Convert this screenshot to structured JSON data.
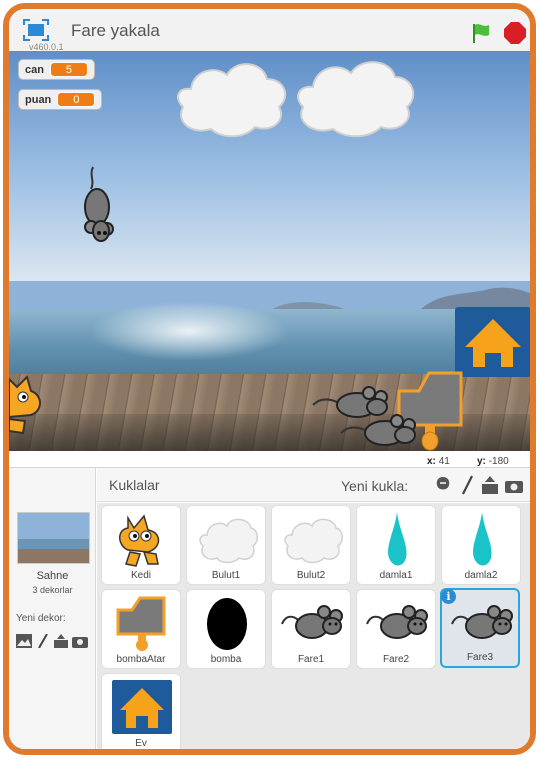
{
  "project": {
    "title": "Fare yakala",
    "version": "v460.0.1"
  },
  "variables": [
    {
      "name": "can",
      "value": "5"
    },
    {
      "name": "puan",
      "value": "0"
    }
  ],
  "coords": {
    "x_label": "x:",
    "x_value": "41",
    "y_label": "y:",
    "y_value": "-180"
  },
  "sprites_pane": {
    "title": "Kuklalar",
    "new_sprite_label": "Yeni kukla:"
  },
  "stage": {
    "name": "Sahne",
    "backdrop_count": "3 dekorlar",
    "new_backdrop_label": "Yeni dekor:"
  },
  "sprites": [
    {
      "name": "Kedi"
    },
    {
      "name": "Bulut1"
    },
    {
      "name": "Bulut2"
    },
    {
      "name": "damla1"
    },
    {
      "name": "damla2"
    },
    {
      "name": "bombaAtar"
    },
    {
      "name": "bomba"
    },
    {
      "name": "Fare1"
    },
    {
      "name": "Fare2"
    },
    {
      "name": "Fare3",
      "selected": true
    },
    {
      "name": "Ev"
    }
  ],
  "colors": {
    "frame": "#e07a2c",
    "monitor_value": "#ee7d16",
    "selection": "#2aa6d9",
    "accent_teal": "#19c3c8"
  }
}
